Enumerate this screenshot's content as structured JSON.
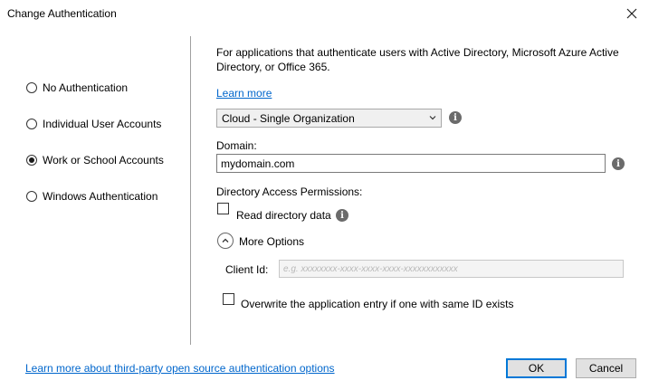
{
  "window": {
    "title": "Change Authentication",
    "close_icon": "close-icon"
  },
  "auth_options": [
    {
      "label": "No Authentication",
      "selected": false
    },
    {
      "label": "Individual User Accounts",
      "selected": false
    },
    {
      "label": "Work or School Accounts",
      "selected": true
    },
    {
      "label": "Windows Authentication",
      "selected": false
    }
  ],
  "details": {
    "description": "For applications that authenticate users with Active Directory, Microsoft Azure Active Directory, or Office 365.",
    "learn_more": "Learn more",
    "org_type_value": "Cloud - Single Organization",
    "domain_label": "Domain:",
    "domain_value": "mydomain.com",
    "permissions_label": "Directory Access Permissions:",
    "read_directory_label": "Read directory data",
    "read_directory_checked": false,
    "more_options_label": "More Options",
    "client_id_label": "Client Id:",
    "client_id_placeholder": "e.g. xxxxxxxx-xxxx-xxxx-xxxx-xxxxxxxxxxxx",
    "overwrite_label": "Overwrite the application entry if one with same ID exists",
    "overwrite_checked": false
  },
  "footer": {
    "third_party_link": "Learn more about third-party open source authentication options",
    "ok_label": "OK",
    "cancel_label": "Cancel"
  }
}
